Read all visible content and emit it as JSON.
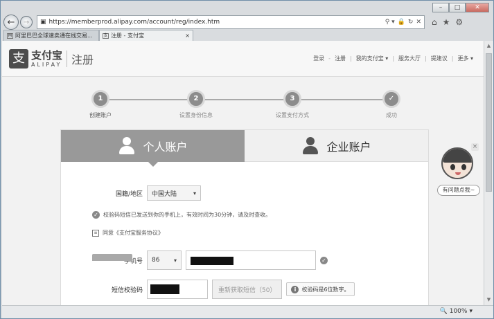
{
  "browser": {
    "controls": {
      "minimize": "–",
      "maximize": "□",
      "close": "✕"
    },
    "nav": {
      "back": "←",
      "forward": "→"
    },
    "address": {
      "url": "https://memberprod.alipay.com/account/reg/index.htm",
      "search": "⚲ ▾",
      "lock": "🔒",
      "refresh": "↻",
      "stop": "✕"
    },
    "top_icons": {
      "home": "⌂",
      "favorites": "★",
      "settings": "⚙"
    },
    "tabs": [
      {
        "label": "阿里巴巴全球速卖通在线交易...",
        "close": "",
        "icon": "M"
      },
      {
        "label": "注册 - 支付宝",
        "close": "×",
        "icon": "支"
      }
    ],
    "zoom": "100%",
    "zoom_icon": "🔍",
    "zoom_caret": "▾"
  },
  "site": {
    "logo_mark": "支",
    "logo_cn": "支付宝",
    "logo_en": "ALIPAY",
    "page_title": "注册",
    "header_links": {
      "login": "登录",
      "sep": "-",
      "register": "注册",
      "pipe": "|",
      "my_alipay": "我的支付宝 ▾",
      "service": "服务大厅",
      "advice": "提建议",
      "more": "更多 ▾"
    }
  },
  "steps": [
    {
      "num": "1",
      "label": "创建账户"
    },
    {
      "num": "2",
      "label": "设置身份信息"
    },
    {
      "num": "3",
      "label": "设置支付方式"
    },
    {
      "num": "✓",
      "label": "成功"
    }
  ],
  "account_tabs": {
    "personal": "个人账户",
    "business": "企业账户"
  },
  "form": {
    "region_label": "国籍/地区",
    "region_value": "中国大陆",
    "phone_label": "手机号",
    "phone_code": "86",
    "sms_label": "短信校验码",
    "resend_label": "重新获取短信（50）",
    "tooltip": "校验码是6位数字。",
    "notice": "校验码短信已发送到你的手机上，有效时间为30分钟，请及时查收。",
    "agree": "同意《支付宝服务协议》",
    "caret": "▾",
    "check": "✓",
    "info": "i",
    "box": "≡"
  },
  "mascot": {
    "close": "×",
    "bubble": "有问题点我~"
  }
}
